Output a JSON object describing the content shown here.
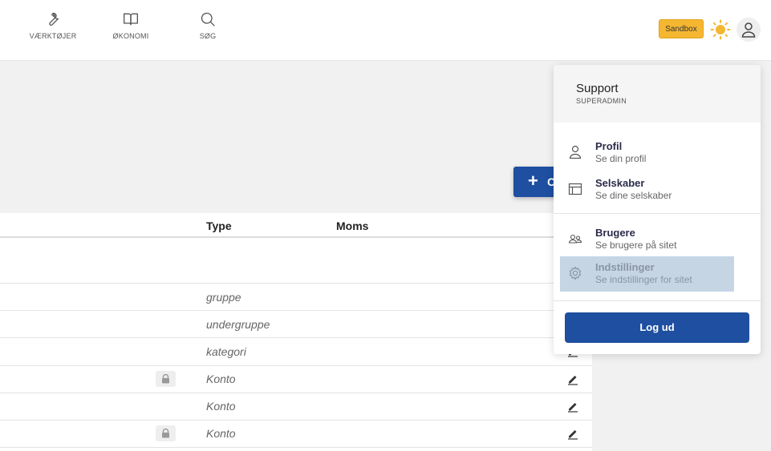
{
  "nav": {
    "items": [
      {
        "label": "VÆRKTØJER",
        "icon": "wrench-icon"
      },
      {
        "label": "ØKONOMI",
        "icon": "book-icon"
      },
      {
        "label": "SØG",
        "icon": "search-icon"
      }
    ]
  },
  "header": {
    "sandbox_label": "Sandbox",
    "theme_icon": "sun-icon",
    "user_icon": "user-icon",
    "accent_color": "#f5b731"
  },
  "create_button": {
    "label": "C"
  },
  "table": {
    "columns": {
      "type": "Type",
      "moms": "Moms"
    },
    "rows": [
      {
        "type": "",
        "locked": false,
        "editable": false
      },
      {
        "type": "gruppe",
        "locked": false,
        "editable": false
      },
      {
        "type": "undergruppe",
        "locked": false,
        "editable": false
      },
      {
        "type": "kategori",
        "locked": false,
        "editable": true
      },
      {
        "type": "Konto",
        "locked": true,
        "editable": true
      },
      {
        "type": "Konto",
        "locked": false,
        "editable": true
      },
      {
        "type": "Konto",
        "locked": true,
        "editable": true
      }
    ]
  },
  "user_menu": {
    "name": "Support",
    "role": "SUPERADMIN",
    "items": [
      {
        "title": "Profil",
        "subtitle": "Se din profil",
        "icon": "user-icon"
      },
      {
        "title": "Selskaber",
        "subtitle": "Se dine selskaber",
        "icon": "table-icon"
      },
      {
        "title": "Brugere",
        "subtitle": "Se brugere på sitet",
        "icon": "users-icon"
      },
      {
        "title": "Indstillinger",
        "subtitle": "Se indstillinger for sitet",
        "icon": "gear-icon",
        "active": true
      }
    ],
    "logout_label": "Log ud",
    "button_color": "#1e4fa0"
  }
}
